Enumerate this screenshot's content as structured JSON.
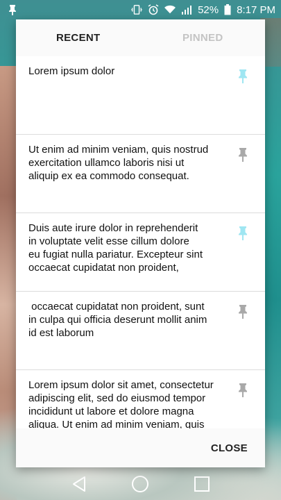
{
  "status_bar": {
    "battery": "52%",
    "time": "8:17 PM",
    "icons": [
      "pin-notification-icon",
      "vibrate-icon",
      "alarm-icon",
      "wifi-icon",
      "signal-icon",
      "battery-icon"
    ]
  },
  "tabs": [
    {
      "label": "RECENT",
      "active": true
    },
    {
      "label": "PINNED",
      "active": false
    }
  ],
  "notes": [
    {
      "text": "Lorem ipsum dolor",
      "pinned": true
    },
    {
      "text": "Ut enim ad minim veniam, quis nostrud\nexercitation ullamco laboris nisi ut\naliquip ex ea commodo consequat.",
      "pinned": false
    },
    {
      "text": "Duis aute irure dolor in reprehenderit\nin voluptate velit esse cillum dolore\neu fugiat nulla pariatur. Excepteur sint\noccaecat cupidatat non proident,",
      "pinned": true
    },
    {
      "text": " occaecat cupidatat non proident, sunt\nin culpa qui officia deserunt mollit anim\nid est laborum",
      "pinned": false
    },
    {
      "text": "Lorem ipsum dolor sit amet, consectetur\nadipiscing elit, sed do eiusmod tempor\nincididunt ut labore et dolore magna\naliqua. Ut enim ad minim veniam, quis",
      "pinned": false
    }
  ],
  "footer": {
    "close_label": "CLOSE"
  },
  "colors": {
    "pinned": "#9fe6f2",
    "unpinned": "#a9a9a9"
  },
  "nav": [
    "back-icon",
    "home-icon",
    "recents-icon"
  ]
}
